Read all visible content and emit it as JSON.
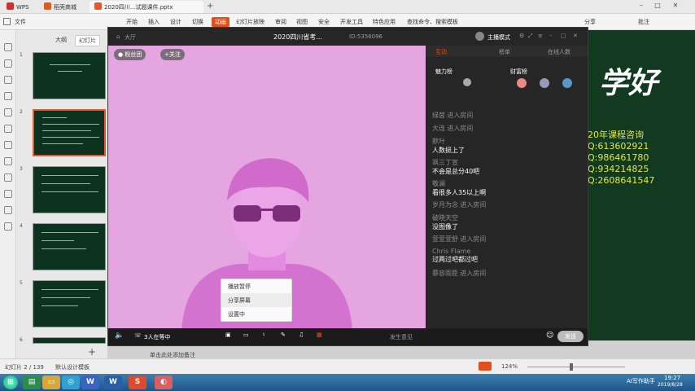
{
  "wps": {
    "tabs": [
      {
        "label": "WPS",
        "color": "#d32f2f"
      },
      {
        "label": "稻壳商城",
        "color": "#e05a1c"
      },
      {
        "label": "2020四川...试题课件.pptx",
        "color": "#e4572e"
      }
    ],
    "menu": [
      "文件",
      "开始",
      "插入",
      "设计",
      "切换",
      "动画",
      "幻灯片放映",
      "审阅",
      "视图",
      "安全",
      "开发工具",
      "特色应用",
      "查找命令、搜索模板"
    ],
    "menu_active_index": 5,
    "right_tools": [
      "分享",
      "批注"
    ],
    "slide_panel_tabs": [
      "大纲",
      "幻灯片"
    ],
    "slide_numbers": [
      "1",
      "2",
      "3",
      "4",
      "5",
      "6"
    ],
    "add_slide": "+",
    "status": {
      "slide_info": "幻灯片 2 / 139",
      "theme": "默认设计模板",
      "notes": "单击此处添加备注",
      "zoom": "124%"
    }
  },
  "slide": {
    "brand_text": "学好",
    "consult_title": "20年课程咨询",
    "qq_list": [
      "Q:613602921",
      "Q:986461780",
      "Q:934214825",
      "Q:2608641547"
    ]
  },
  "live": {
    "title": "2020四川省考...",
    "room_id": "ID:5356096",
    "lobby_label": "大厅",
    "host_label": "主播模式",
    "host_name": "粉丝团",
    "follow_label": "+关注",
    "tabs": [
      "互动",
      "榜单",
      "在线人数"
    ],
    "rank_left_label": "魅力榜",
    "rank_right_label": "财富榜",
    "chat": [
      {
        "name": "绿茵",
        "action": "进入房间"
      },
      {
        "name": "大连",
        "action": "进入房间"
      },
      {
        "name": "默叶",
        "msg": "人数挺上了"
      },
      {
        "name": "飒三丁宣",
        "msg": "不会是总分40吧"
      },
      {
        "name": "敬澜",
        "msg": "看很多人35以上啊"
      },
      {
        "name": "岁月为念",
        "action": "进入房间"
      },
      {
        "name": "破晓天空",
        "msg": "没图像了"
      },
      {
        "name": "萱萱萱舒",
        "action": "进入房间"
      },
      {
        "name": "Chris Flame",
        "msg": "过两过吧都过吧"
      },
      {
        "name": "慕容雨臣",
        "action": "进入房间"
      }
    ],
    "bottom_left": "3人在等中",
    "bottom_right": "发生意见",
    "send_label": "发送",
    "popup": [
      "播放暂停",
      "分享屏幕",
      "设置中"
    ],
    "popup_highlight": 1
  },
  "taskbar": {
    "time": "19:27",
    "date": "2019/8/28",
    "ai_label": "AI写作助手"
  },
  "colors": {
    "accent": "#e0501a",
    "video_bg": "#e5a5e0",
    "slide_bg": "#113a21",
    "consult": "#e4e836"
  }
}
